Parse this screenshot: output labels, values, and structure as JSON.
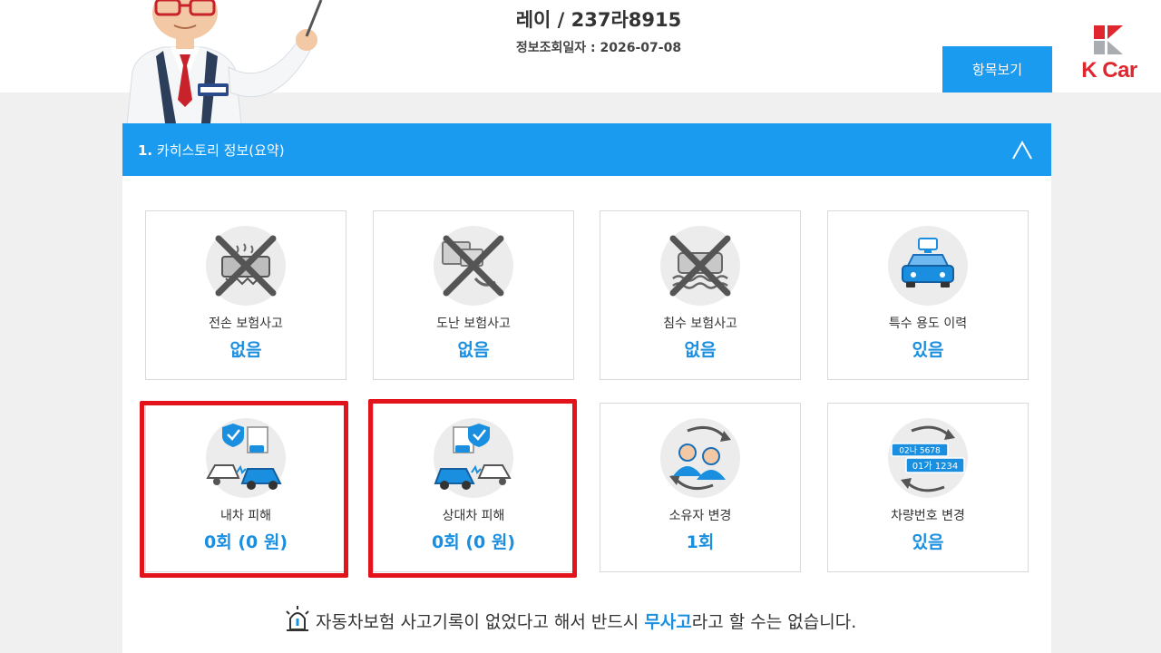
{
  "header": {
    "vehicle_title": "레이 / 237라8915",
    "lookup_label": "정보조회일자 : ",
    "lookup_date": "2026-07-08",
    "items_button": "항목보기"
  },
  "brand": {
    "name": "K Car",
    "color": "#e0262e"
  },
  "panel": {
    "number": "1.",
    "title": " 카히스토리 정보(요약)",
    "accent_color": "#1a9bf0"
  },
  "cards": [
    {
      "label": "전손 보험사고",
      "value": "없음",
      "icon": "total-loss-crossed-icon"
    },
    {
      "label": "도난 보험사고",
      "value": "없음",
      "icon": "theft-crossed-icon"
    },
    {
      "label": "침수 보험사고",
      "value": "없음",
      "icon": "flood-crossed-icon"
    },
    {
      "label": "특수 용도 이력",
      "value": "있음",
      "icon": "special-use-taxi-icon"
    },
    {
      "label": "내차 피해",
      "value": "0회 (0 원)",
      "icon": "my-car-damage-icon"
    },
    {
      "label": "상대차 피해",
      "value": "0회 (0 원)",
      "icon": "other-car-damage-icon"
    },
    {
      "label": "소유자 변경",
      "value": "1회",
      "icon": "owner-change-icon"
    },
    {
      "label": "차량번호 변경",
      "value": "있음",
      "icon": "plate-change-icon"
    }
  ],
  "plates": {
    "old": "02나 5678",
    "new": "01가 1234"
  },
  "notice": {
    "before": "자동차보험 사고기록이 없었다고 해서 반드시 ",
    "emphasis": "무사고",
    "after": "라고 할 수는 없습니다."
  }
}
